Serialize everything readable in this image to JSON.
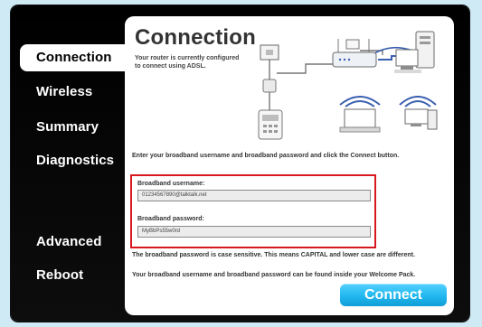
{
  "sidebar": {
    "items": [
      {
        "label": "Connection",
        "active": true
      },
      {
        "label": "Wireless",
        "active": false
      },
      {
        "label": "Summary",
        "active": false
      },
      {
        "label": "Diagnostics",
        "active": false
      },
      {
        "label": "Advanced",
        "active": false
      },
      {
        "label": "Reboot",
        "active": false
      }
    ]
  },
  "panel": {
    "title": "Connection",
    "description": "Your router is currently configured to connect using ADSL.",
    "instructions": "Enter your broadband username and broadband password and click the Connect button.",
    "username_label": "Broadband username:",
    "username_value": "01234567890@talktalk.net",
    "password_label": "Broadband password:",
    "password_value": "MyBbPs55w0rd",
    "note_case": "The broadband password is case sensitive. This means CAPITAL and lower case are different.",
    "note_welcome": "Your broadband username and broadband password can be found inside your Welcome Pack.",
    "connect_label": "Connect"
  },
  "colors": {
    "accent": "#21b8ef",
    "highlight": "#d7191f"
  }
}
